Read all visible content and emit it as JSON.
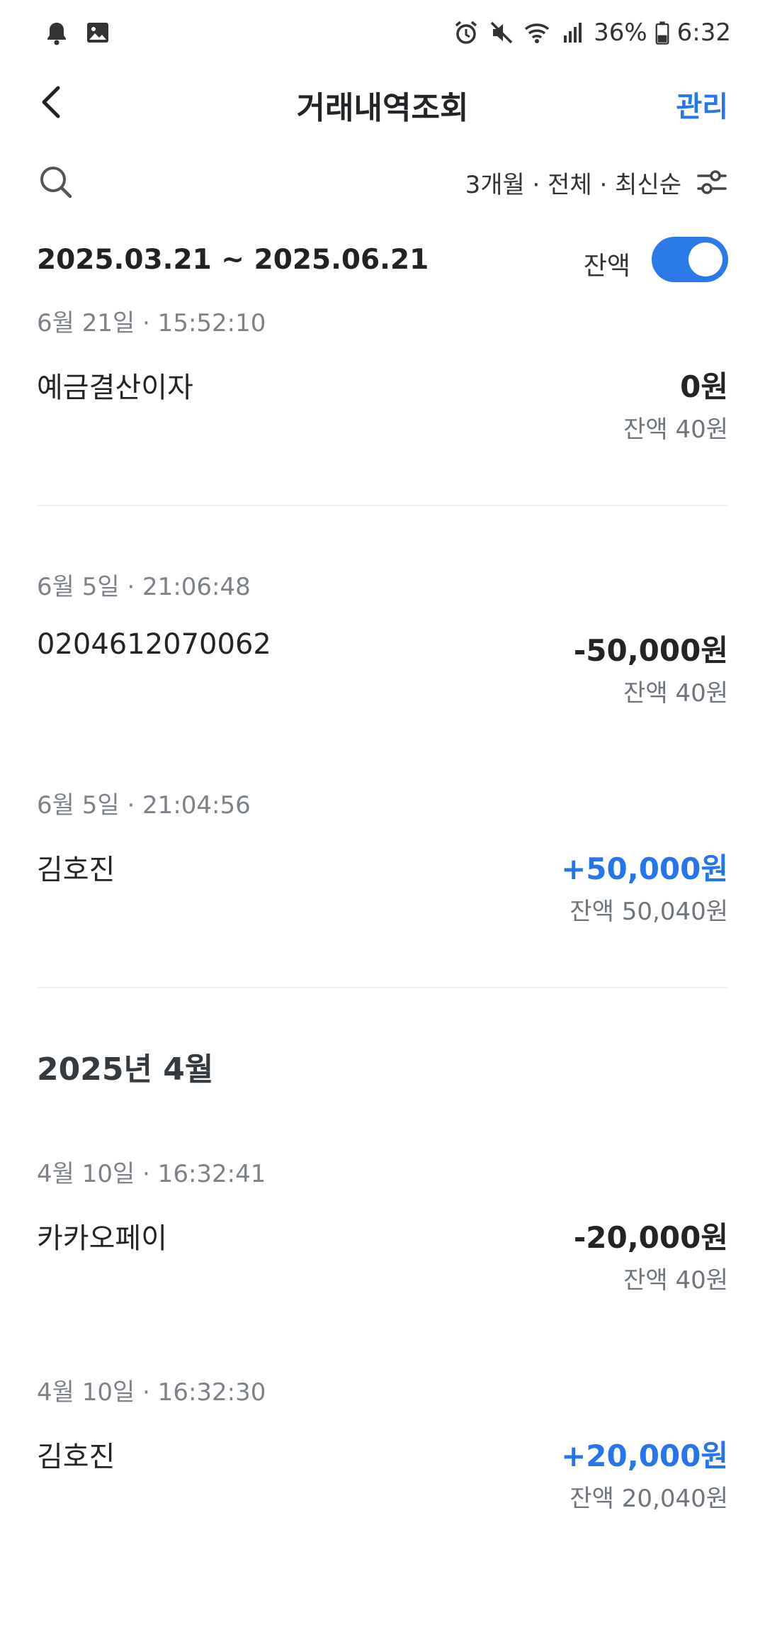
{
  "status_bar": {
    "battery": "36%",
    "time": "6:32",
    "icons": [
      "bell-icon",
      "gallery-icon",
      "alarm-icon",
      "mute-icon",
      "wifi-icon",
      "signal-icon",
      "battery-icon"
    ]
  },
  "header": {
    "back_icon": "chevron-left-icon",
    "title": "거래내역조회",
    "manage_label": "관리"
  },
  "filter": {
    "search_icon": "search-icon",
    "summary": "3개월 · 전체 · 최신순",
    "filter_icon": "sliders-icon"
  },
  "range": {
    "period": "2025.03.21 ~ 2025.06.21",
    "balance_label": "잔액",
    "balance_toggle_on": true
  },
  "groups": [
    {
      "month": "",
      "transactions": [
        {
          "time": "6월 21일 · 15:52:10",
          "name": "예금결산이자",
          "amount": "0원",
          "balance": "잔액 40원",
          "type": "neutral"
        }
      ]
    },
    {
      "month": "",
      "transactions": [
        {
          "time": "6월 5일 · 21:06:48",
          "name": "0204612070062",
          "amount": "-50,000원",
          "balance": "잔액 40원",
          "type": "minus"
        },
        {
          "time": "6월 5일 · 21:04:56",
          "name": "김호진",
          "amount": "+50,000원",
          "balance": "잔액 50,040원",
          "type": "plus"
        }
      ]
    },
    {
      "month": "2025년 4월",
      "transactions": [
        {
          "time": "4월 10일 · 16:32:41",
          "name": "카카오페이",
          "amount": "-20,000원",
          "balance": "잔액 40원",
          "type": "minus"
        },
        {
          "time": "4월 10일 · 16:32:30",
          "name": "김호진",
          "amount": "+20,000원",
          "balance": "잔액 20,040원",
          "type": "plus"
        }
      ]
    }
  ],
  "colors": {
    "accent": "#2575ec",
    "text_primary": "#222427",
    "text_secondary": "#7c8289",
    "divider": "#eceef0"
  }
}
